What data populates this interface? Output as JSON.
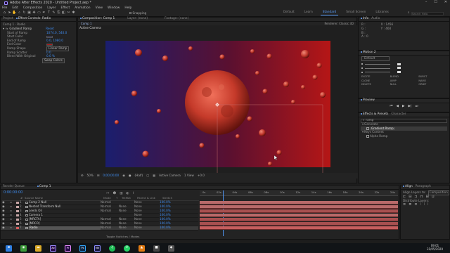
{
  "app": {
    "title": "Adobe After Effects 2020 - Untitled Project.aep *",
    "window_controls": [
      "–",
      "☐",
      "✕"
    ]
  },
  "menu": [
    "File",
    "Edit",
    "Composition",
    "Layer",
    "Effect",
    "Animation",
    "View",
    "Window",
    "Help"
  ],
  "toolbar": {
    "snapping_label": "Snapping",
    "workspaces": [
      "Default",
      "Learn",
      "Standard",
      "Small Screen",
      "Libraries"
    ],
    "active_workspace": "Standard",
    "search_placeholder": "Search Help"
  },
  "left_panel": {
    "tabs": [
      "Project",
      "Effect Controls: Radio"
    ],
    "active_tab": "Effect Controls: Radio",
    "breadcrumb": "Comp 1 · Radio",
    "effect_name": "Gradient Ramp",
    "reset_label": "Reset",
    "properties": [
      {
        "label": "Start of Ramp",
        "value": "1074.0, 540.0"
      },
      {
        "label": "Start Color",
        "value": ""
      },
      {
        "label": "End of Ramp",
        "value": "0.0, 1080.0"
      },
      {
        "label": "End Color",
        "value": ""
      },
      {
        "label": "Ramp Shape",
        "value": "Linear Ramp"
      },
      {
        "label": "Ramp Scatter",
        "value": "0.0"
      },
      {
        "label": "Blend With Original",
        "value": "0.0 %"
      }
    ],
    "swap_label": "Swap Colors"
  },
  "comp_panel": {
    "tabs": [
      "Composition: Comp 1",
      "Layer: (none)",
      "Footage: (none)"
    ],
    "comp_tab": "Comp 1",
    "camera_label": "Active Camera",
    "renderer_label": "Renderer: Classic 3D",
    "zoom": "50%",
    "timecode": "0;00;00;00",
    "resolution": "(Half)",
    "view_camera": "Active Camera",
    "views": "1 View",
    "exposure": "+0.0"
  },
  "right_panel": {
    "info_tabs": [
      "Info",
      "Audio"
    ],
    "info_values": [
      "R :",
      "G :",
      "B :",
      "A : 0",
      "X : 1456",
      "Y : 460"
    ],
    "motion_title": "Motion 2",
    "motion_preset": "Default",
    "motion_buttons": [
      "EXCITE",
      "BLEND",
      "BURST",
      "CLONE",
      "JUMP",
      "NAME",
      "DELETE",
      "NULL",
      "ORBIT"
    ],
    "preview_title": "Preview",
    "effects_tabs": [
      "Effects & Presets",
      "Character"
    ],
    "effects_search": "ramp",
    "effects_tree": [
      {
        "label": "Generate",
        "indent": 0
      },
      {
        "label": "Gradient Ramp",
        "indent": 1,
        "selected": true
      },
      {
        "label": "Keys Content",
        "indent": 0
      },
      {
        "label": "Alpha Ramp",
        "indent": 1
      }
    ]
  },
  "timeline": {
    "tabs": [
      "Render Queue",
      "Comp 1"
    ],
    "active_tab": "Comp 1",
    "timecode": "0:00:00:00",
    "columns": [
      "#",
      "Source Name",
      "Mode",
      "T",
      "TrkMat",
      "Parent & Link",
      "Stretch"
    ],
    "ruler": [
      "0s",
      "02s",
      "04s",
      "06s",
      "08s",
      "10s",
      "12s",
      "14s",
      "16s",
      "18s",
      "20s",
      "22s",
      "24s"
    ],
    "layers": [
      {
        "num": "1",
        "name": "Comp 2 Null",
        "mode": "Normal",
        "trkmat": "",
        "parent": "None",
        "stretch": "100.0%",
        "color": "#c6a5a5"
      },
      {
        "num": "2",
        "name": "Nested Transform Null",
        "mode": "Normal",
        "trkmat": "None",
        "parent": "None",
        "stretch": "100.0%",
        "color": "#c6a5a5"
      },
      {
        "num": "3",
        "name": "Leeds Oil",
        "mode": "Normal",
        "trkmat": "None",
        "parent": "None",
        "stretch": "100.0%",
        "color": "#c6a5a5"
      },
      {
        "num": "4",
        "name": "Camera 1",
        "mode": "",
        "trkmat": "",
        "parent": "None",
        "stretch": "100.0%",
        "color": "#c6a5a5"
      },
      {
        "num": "5",
        "name": "[MRCTA]",
        "mode": "Normal",
        "trkmat": "None",
        "parent": "None",
        "stretch": "100.0%",
        "color": "#c6a5a5"
      },
      {
        "num": "6",
        "name": "[MRCO]",
        "mode": "Normal",
        "trkmat": "None",
        "parent": "None",
        "stretch": "100.0%",
        "color": "#c6a5a5"
      },
      {
        "num": "7",
        "name": "Radio",
        "mode": "Normal",
        "trkmat": "None",
        "parent": "None",
        "stretch": "100.0%",
        "color": "#d65b5b",
        "selected": true
      }
    ],
    "footer": "Toggle Switches / Modes"
  },
  "align_panel": {
    "tabs": [
      "Align",
      "Paragraph"
    ],
    "align_layers_to": "Align Layers to:",
    "align_target": "Composition",
    "distribute_label": "Distribute Layers:"
  },
  "taskbar": {
    "time": "09:01",
    "date": "31/05/2020",
    "apps": [
      {
        "icon": "windows-icon",
        "color": "#2d7de0",
        "glyph": "⊞"
      },
      {
        "icon": "chrome-icon",
        "color": "#3c9a3a",
        "glyph": "◉"
      },
      {
        "icon": "folder-icon",
        "color": "#d8a928",
        "glyph": "▬"
      },
      {
        "icon": "after-effects-icon",
        "color": "#2a0b4a",
        "glyph": "Ae"
      },
      {
        "icon": "premiere-icon",
        "color": "#2a0b4a",
        "glyph": "Pr"
      },
      {
        "icon": "photoshop-icon",
        "color": "#0f2a4a",
        "glyph": "Ps"
      },
      {
        "icon": "media-encoder-icon",
        "color": "#1a1a40",
        "glyph": "Me"
      },
      {
        "icon": "spotify-icon",
        "color": "#1db954",
        "glyph": "♫"
      },
      {
        "icon": "whatsapp-icon",
        "color": "#25d366",
        "glyph": "✆"
      },
      {
        "icon": "vlc-icon",
        "color": "#e07a12",
        "glyph": "▲"
      },
      {
        "icon": "app-icon",
        "color": "#444",
        "glyph": "■"
      },
      {
        "icon": "app2-icon",
        "color": "#555",
        "glyph": "◆"
      }
    ]
  }
}
